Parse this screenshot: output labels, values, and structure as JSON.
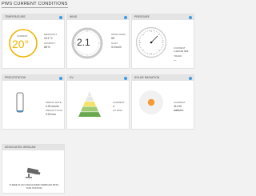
{
  "page": {
    "title": "PWS CURRENT CONDITIONS"
  },
  "temperature": {
    "header": "TEMPERATURE",
    "current_label": "CURRENT",
    "current_value": "20°",
    "dewpoint_label": "DEWPOINT",
    "dewpoint_value": "15.2 °C",
    "humidity_label": "HUMIDITY",
    "humidity_value": "88 %",
    "ring_color": "#f0b400"
  },
  "wind": {
    "header": "WIND",
    "speed_value": "2.1",
    "direction_label": "WIND FROM",
    "direction_value": "SE",
    "gust_label": "GUST",
    "gust_value": "3.0 km/h"
  },
  "pressure": {
    "header": "PRESSURE",
    "current_label": "CURRENT",
    "current_value": "1,024.00 hPa",
    "trend_label": "TREND",
    "trend_value": "—"
  },
  "precipitation": {
    "header": "PRECIPITATION",
    "precip_label": "PRECIP RATE",
    "precip_value": "0.00 mm/hr",
    "total_label": "PRECIP TOTAL",
    "total_value": "0.00 mm",
    "fill_fraction": 0.0
  },
  "uv": {
    "header": "UV",
    "current_label": "CURRENT",
    "current_value": "4",
    "level_label": "UV RISK",
    "level_value": "",
    "level_colors": [
      "#e8e8e8",
      "#e8e8e8",
      "#f3e36a",
      "#9fcb73",
      "#6aa84f"
    ]
  },
  "solar": {
    "header": "SOLAR RADIATION",
    "current_label": "CURRENT",
    "current_value": "411.53",
    "current_unit": "watts/m²",
    "sun_color": "#f59a36"
  },
  "webcam": {
    "header": "ASSOCIATED WEBCAM",
    "message": "THERE IS NO ASSOCIATED WEBCAM WITH THIS STATION"
  }
}
